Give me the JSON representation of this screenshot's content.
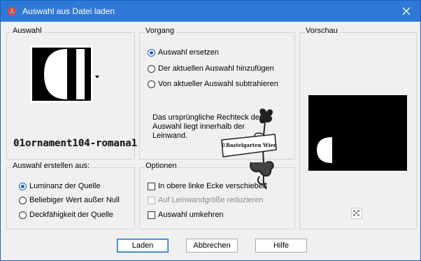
{
  "window": {
    "title": "Auswahl aus Datei laden"
  },
  "groups": {
    "auswahl": {
      "title": "Auswahl"
    },
    "vorgang": {
      "title": "Vorgang",
      "options": [
        {
          "label": "Auswahl ersetzen",
          "selected": true
        },
        {
          "label": "Der aktuellen Auswahl hinzufügen",
          "selected": false
        },
        {
          "label": "Von aktueller Auswahl subtrahieren",
          "selected": false
        }
      ],
      "description": "Das ursprüngliche Rechteck der Auswahl liegt innerhalb der Leinwand."
    },
    "vorschau": {
      "title": "Vorschau"
    },
    "erstellen": {
      "title": "Auswahl erstellen aus:",
      "options": [
        {
          "label": "Luminanz der Quelle",
          "selected": true
        },
        {
          "label": "Beliebiger Wert außer Null",
          "selected": false
        },
        {
          "label": "Deckfähigkeit der Quelle",
          "selected": false
        }
      ]
    },
    "optionen": {
      "title": "Optionen",
      "checks": [
        {
          "label": "In obere linke Ecke verschieben",
          "checked": false,
          "enabled": true
        },
        {
          "label": "Auf Leinwandgröße reduzieren",
          "checked": false,
          "enabled": false
        },
        {
          "label": "Auswahl umkehren",
          "checked": false,
          "enabled": true
        }
      ]
    }
  },
  "watermark": {
    "text": "01ornament104-romana1",
    "stamp_text": "©Bastelgarten Wien"
  },
  "buttons": {
    "laden": "Laden",
    "abbrechen": "Abbrechen",
    "hilfe": "Hilfe"
  },
  "icons": {
    "app": "app-icon",
    "close": "close-icon",
    "dropdown": "dropdown-arrow-icon",
    "checker": "transparency-checker-icon"
  }
}
